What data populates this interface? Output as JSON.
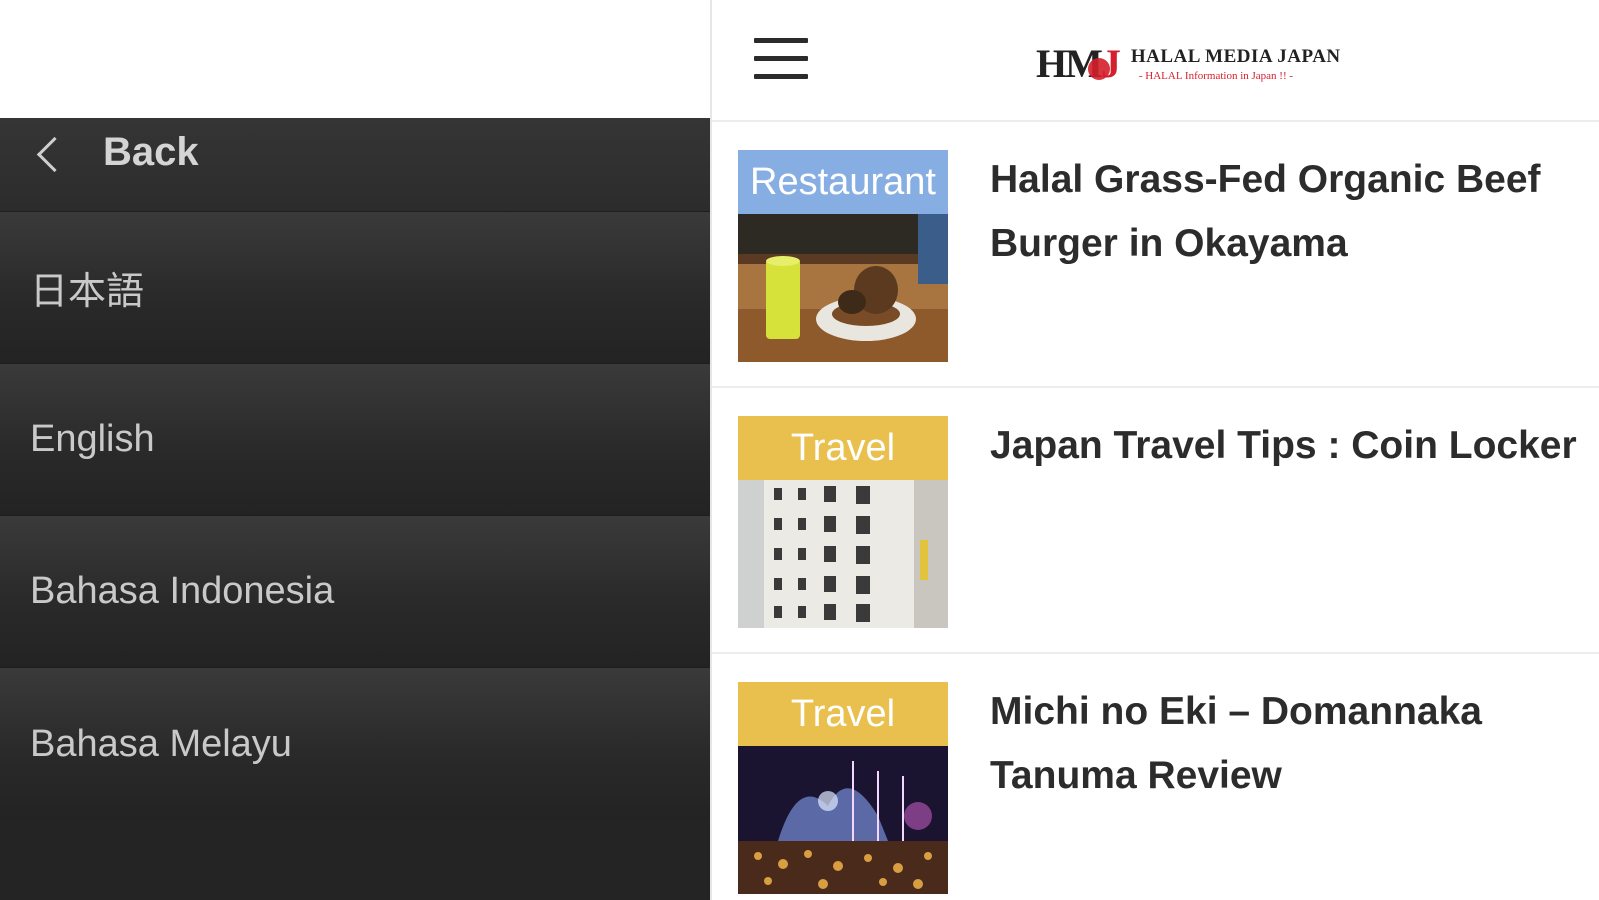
{
  "drawer": {
    "back_label": "Back",
    "languages": [
      {
        "label": "日本語"
      },
      {
        "label": "English"
      },
      {
        "label": "Bahasa Indonesia"
      },
      {
        "label": "Bahasa Melayu"
      }
    ]
  },
  "header": {
    "logo_mark_hm": "HM",
    "logo_mark_j": "J",
    "logo_name": "HALAL MEDIA JAPAN",
    "logo_tagline": "- HALAL Information in Japan !! -"
  },
  "articles": [
    {
      "category": "Restaurant",
      "category_color": "#86aee3",
      "title": "Halal Grass-Fed Organic Beef Burger in Okayama",
      "thumbnail": "burger-photo"
    },
    {
      "category": "Travel",
      "category_color": "#e9c04d",
      "title": "Japan Travel Tips : Coin Locker",
      "thumbnail": "coin-locker-photo"
    },
    {
      "category": "Travel",
      "category_color": "#e9c04d",
      "title": "Michi no Eki – Domannaka Tanuma Review",
      "thumbnail": "night-illumination-photo"
    }
  ]
}
